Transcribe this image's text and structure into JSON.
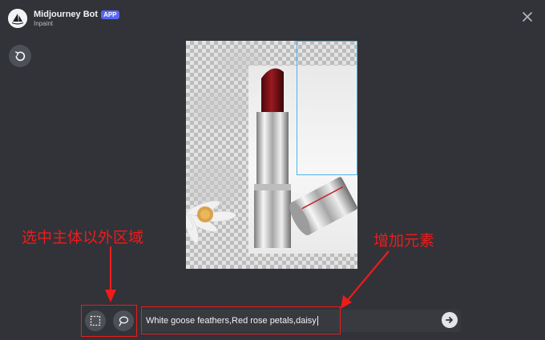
{
  "header": {
    "bot_name": "Midjourney Bot",
    "badge": "APP",
    "subtitle": "Inpaint"
  },
  "icons": {
    "close": "close-icon",
    "undo": "undo-icon",
    "rect_select": "rectangle-select-icon",
    "lasso_select": "lasso-select-icon",
    "send": "send-arrow-icon"
  },
  "prompt": {
    "value": "White goose feathers,Red rose petals,daisy"
  },
  "annotations": {
    "left": "选中主体以外区域",
    "right": "增加元素"
  },
  "colors": {
    "background": "#313338",
    "accent": "#5865f2",
    "annotation": "#ee1b1b",
    "selection": "#4fb3e8"
  }
}
